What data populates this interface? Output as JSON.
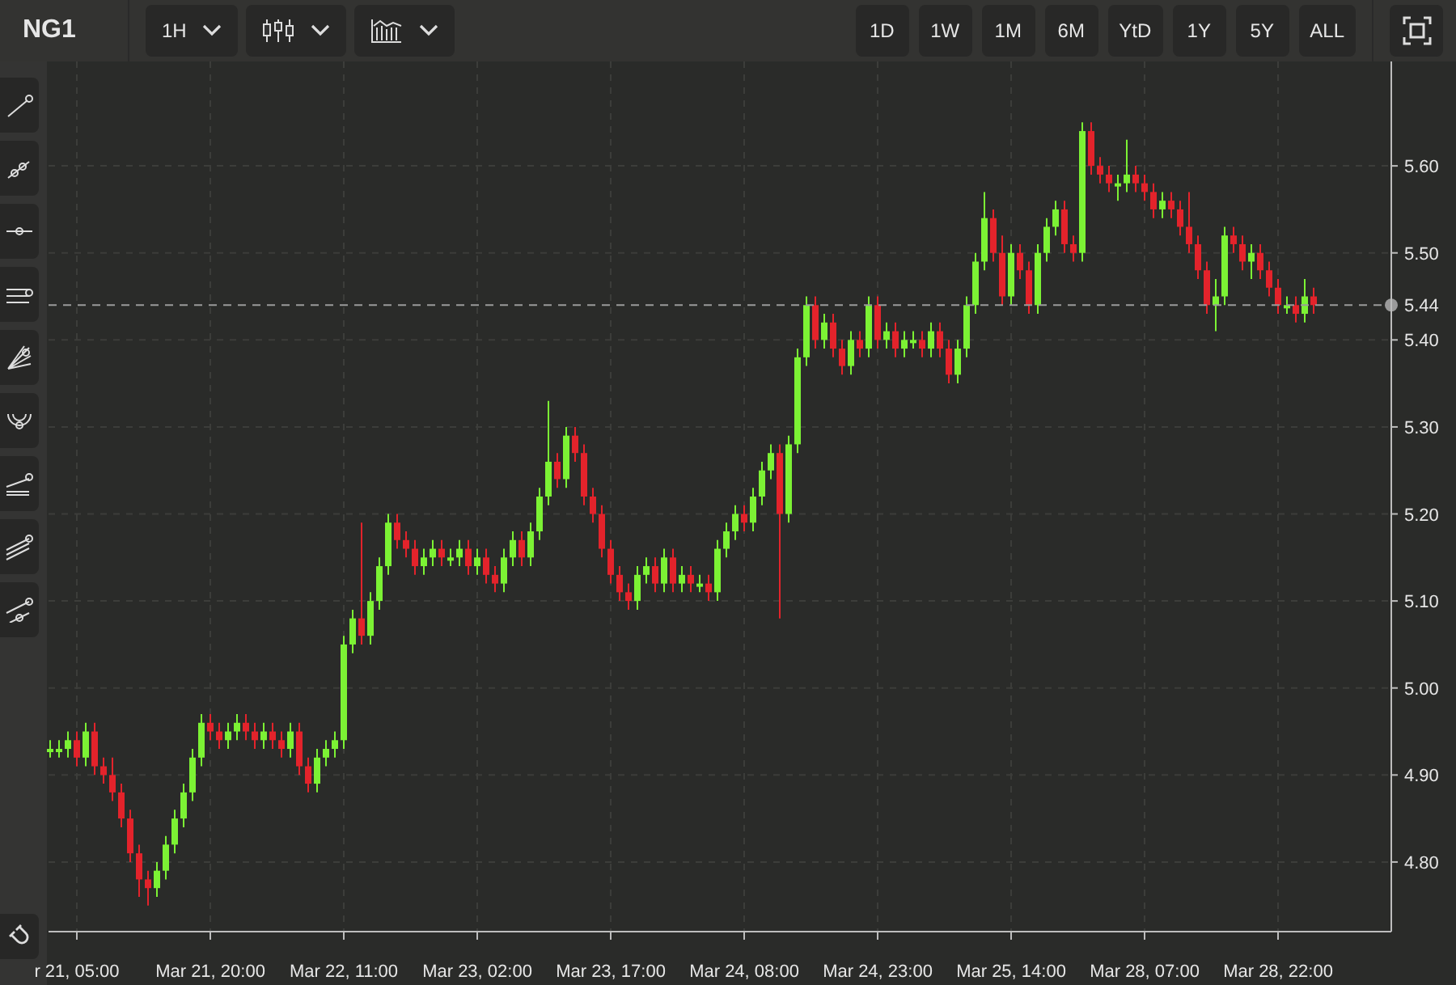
{
  "symbol": "NG1",
  "interval": {
    "label": "1H"
  },
  "range_buttons": [
    "1D",
    "1W",
    "1M",
    "6M",
    "YtD",
    "1Y",
    "5Y",
    "ALL"
  ],
  "chart": {
    "chart_data": {
      "type": "candlestick",
      "grid": true,
      "ylim": [
        4.72,
        5.72
      ],
      "ref_lines": [
        {
          "axis": "y",
          "value": 5.44,
          "label": "5.44"
        }
      ],
      "categories": [
        null,
        null,
        null,
        "r 21, 05:00",
        null,
        null,
        null,
        null,
        null,
        null,
        null,
        null,
        null,
        null,
        null,
        null,
        null,
        null,
        "Mar 21, 20:00",
        null,
        null,
        null,
        null,
        null,
        null,
        null,
        null,
        null,
        null,
        null,
        null,
        null,
        null,
        "Mar 22, 11:00",
        null,
        null,
        null,
        null,
        null,
        null,
        null,
        null,
        null,
        null,
        null,
        null,
        null,
        null,
        "Mar 23, 02:00",
        null,
        null,
        null,
        null,
        null,
        null,
        null,
        null,
        null,
        null,
        null,
        null,
        null,
        null,
        "Mar 23, 17:00",
        null,
        null,
        null,
        null,
        null,
        null,
        null,
        null,
        null,
        null,
        null,
        null,
        null,
        null,
        "Mar 24, 08:00",
        null,
        null,
        null,
        null,
        null,
        null,
        null,
        null,
        null,
        null,
        null,
        null,
        null,
        null,
        "Mar 24, 23:00",
        null,
        null,
        null,
        null,
        null,
        null,
        null,
        null,
        null,
        null,
        null,
        null,
        null,
        null,
        "Mar 25, 14:00",
        null,
        null,
        null,
        null,
        null,
        null,
        null,
        null,
        null,
        null,
        null,
        null,
        null,
        null,
        "Mar 28, 07:00",
        null,
        null,
        null,
        null,
        null,
        null,
        null,
        null,
        null,
        null,
        null,
        null,
        null,
        null,
        "Mar 28, 22:00",
        null,
        null,
        null,
        null
      ],
      "yticks": [
        {
          "value": 5.6,
          "label": "5.60"
        },
        {
          "value": 5.5,
          "label": "5.50"
        },
        {
          "value": 5.4,
          "label": "5.40"
        },
        {
          "value": 5.3,
          "label": "5.30"
        },
        {
          "value": 5.2,
          "label": "5.20"
        },
        {
          "value": 5.1,
          "label": "5.10"
        },
        {
          "value": 5.0,
          "label": "5.00"
        },
        {
          "value": 4.9,
          "label": "4.90"
        },
        {
          "value": 4.8,
          "label": "4.80"
        }
      ],
      "ohlc": [
        [
          4.93,
          4.94,
          4.92,
          4.93
        ],
        [
          4.93,
          4.94,
          4.92,
          4.93
        ],
        [
          4.93,
          4.95,
          4.92,
          4.94
        ],
        [
          4.94,
          4.95,
          4.91,
          4.92
        ],
        [
          4.92,
          4.96,
          4.91,
          4.95
        ],
        [
          4.95,
          4.96,
          4.9,
          4.91
        ],
        [
          4.91,
          4.92,
          4.89,
          4.9
        ],
        [
          4.9,
          4.92,
          4.87,
          4.88
        ],
        [
          4.88,
          4.89,
          4.84,
          4.85
        ],
        [
          4.85,
          4.86,
          4.8,
          4.81
        ],
        [
          4.81,
          4.82,
          4.76,
          4.78
        ],
        [
          4.78,
          4.79,
          4.75,
          4.77
        ],
        [
          4.77,
          4.8,
          4.76,
          4.79
        ],
        [
          4.79,
          4.83,
          4.78,
          4.82
        ],
        [
          4.82,
          4.86,
          4.81,
          4.85
        ],
        [
          4.85,
          4.89,
          4.84,
          4.88
        ],
        [
          4.88,
          4.93,
          4.87,
          4.92
        ],
        [
          4.92,
          4.97,
          4.91,
          4.96
        ],
        [
          4.96,
          4.97,
          4.94,
          4.95
        ],
        [
          4.95,
          4.96,
          4.93,
          4.94
        ],
        [
          4.94,
          4.96,
          4.93,
          4.95
        ],
        [
          4.95,
          4.97,
          4.94,
          4.96
        ],
        [
          4.96,
          4.97,
          4.94,
          4.95
        ],
        [
          4.95,
          4.96,
          4.93,
          4.94
        ],
        [
          4.94,
          4.96,
          4.93,
          4.95
        ],
        [
          4.95,
          4.96,
          4.93,
          4.94
        ],
        [
          4.94,
          4.95,
          4.92,
          4.93
        ],
        [
          4.93,
          4.96,
          4.92,
          4.95
        ],
        [
          4.95,
          4.96,
          4.9,
          4.91
        ],
        [
          4.91,
          4.92,
          4.88,
          4.89
        ],
        [
          4.89,
          4.93,
          4.88,
          4.92
        ],
        [
          4.92,
          4.94,
          4.91,
          4.93
        ],
        [
          4.93,
          4.95,
          4.92,
          4.94
        ],
        [
          4.94,
          5.06,
          4.93,
          5.05
        ],
        [
          5.05,
          5.09,
          5.04,
          5.08
        ],
        [
          5.08,
          5.19,
          5.05,
          5.06
        ],
        [
          5.06,
          5.11,
          5.05,
          5.1
        ],
        [
          5.1,
          5.15,
          5.09,
          5.14
        ],
        [
          5.14,
          5.2,
          5.13,
          5.19
        ],
        [
          5.19,
          5.2,
          5.16,
          5.17
        ],
        [
          5.17,
          5.18,
          5.15,
          5.16
        ],
        [
          5.16,
          5.17,
          5.13,
          5.14
        ],
        [
          5.14,
          5.16,
          5.13,
          5.15
        ],
        [
          5.15,
          5.17,
          5.14,
          5.16
        ],
        [
          5.16,
          5.17,
          5.14,
          5.15
        ],
        [
          5.15,
          5.16,
          5.14,
          5.15
        ],
        [
          5.15,
          5.17,
          5.14,
          5.16
        ],
        [
          5.16,
          5.17,
          5.13,
          5.14
        ],
        [
          5.14,
          5.16,
          5.13,
          5.15
        ],
        [
          5.15,
          5.16,
          5.12,
          5.13
        ],
        [
          5.13,
          5.14,
          5.11,
          5.12
        ],
        [
          5.12,
          5.16,
          5.11,
          5.15
        ],
        [
          5.15,
          5.18,
          5.14,
          5.17
        ],
        [
          5.17,
          5.18,
          5.14,
          5.15
        ],
        [
          5.15,
          5.19,
          5.14,
          5.18
        ],
        [
          5.18,
          5.23,
          5.17,
          5.22
        ],
        [
          5.22,
          5.33,
          5.21,
          5.26
        ],
        [
          5.26,
          5.27,
          5.23,
          5.24
        ],
        [
          5.24,
          5.3,
          5.23,
          5.29
        ],
        [
          5.29,
          5.3,
          5.26,
          5.27
        ],
        [
          5.27,
          5.28,
          5.21,
          5.22
        ],
        [
          5.22,
          5.23,
          5.19,
          5.2
        ],
        [
          5.2,
          5.21,
          5.15,
          5.16
        ],
        [
          5.16,
          5.17,
          5.12,
          5.13
        ],
        [
          5.13,
          5.14,
          5.1,
          5.11
        ],
        [
          5.11,
          5.12,
          5.09,
          5.1
        ],
        [
          5.1,
          5.14,
          5.09,
          5.13
        ],
        [
          5.13,
          5.15,
          5.12,
          5.14
        ],
        [
          5.14,
          5.15,
          5.11,
          5.12
        ],
        [
          5.12,
          5.16,
          5.11,
          5.15
        ],
        [
          5.15,
          5.16,
          5.11,
          5.12
        ],
        [
          5.12,
          5.14,
          5.11,
          5.13
        ],
        [
          5.13,
          5.14,
          5.11,
          5.12
        ],
        [
          5.12,
          5.13,
          5.11,
          5.12
        ],
        [
          5.12,
          5.13,
          5.1,
          5.11
        ],
        [
          5.11,
          5.17,
          5.1,
          5.16
        ],
        [
          5.16,
          5.19,
          5.15,
          5.18
        ],
        [
          5.18,
          5.21,
          5.17,
          5.2
        ],
        [
          5.2,
          5.21,
          5.18,
          5.19
        ],
        [
          5.19,
          5.23,
          5.18,
          5.22
        ],
        [
          5.22,
          5.26,
          5.21,
          5.25
        ],
        [
          5.25,
          5.28,
          5.24,
          5.27
        ],
        [
          5.27,
          5.28,
          5.08,
          5.2
        ],
        [
          5.2,
          5.29,
          5.19,
          5.28
        ],
        [
          5.28,
          5.39,
          5.27,
          5.38
        ],
        [
          5.38,
          5.45,
          5.37,
          5.44
        ],
        [
          5.44,
          5.45,
          5.39,
          5.4
        ],
        [
          5.4,
          5.43,
          5.39,
          5.42
        ],
        [
          5.42,
          5.43,
          5.38,
          5.39
        ],
        [
          5.39,
          5.4,
          5.36,
          5.37
        ],
        [
          5.37,
          5.41,
          5.36,
          5.4
        ],
        [
          5.4,
          5.41,
          5.38,
          5.39
        ],
        [
          5.39,
          5.45,
          5.38,
          5.44
        ],
        [
          5.44,
          5.45,
          5.39,
          5.4
        ],
        [
          5.4,
          5.42,
          5.39,
          5.41
        ],
        [
          5.41,
          5.42,
          5.38,
          5.39
        ],
        [
          5.39,
          5.41,
          5.38,
          5.4
        ],
        [
          5.4,
          5.41,
          5.39,
          5.4
        ],
        [
          5.4,
          5.41,
          5.38,
          5.39
        ],
        [
          5.39,
          5.42,
          5.38,
          5.41
        ],
        [
          5.41,
          5.42,
          5.38,
          5.39
        ],
        [
          5.39,
          5.4,
          5.35,
          5.36
        ],
        [
          5.36,
          5.4,
          5.35,
          5.39
        ],
        [
          5.39,
          5.45,
          5.38,
          5.44
        ],
        [
          5.44,
          5.5,
          5.43,
          5.49
        ],
        [
          5.49,
          5.57,
          5.48,
          5.54
        ],
        [
          5.54,
          5.55,
          5.49,
          5.5
        ],
        [
          5.5,
          5.52,
          5.44,
          5.45
        ],
        [
          5.45,
          5.51,
          5.44,
          5.5
        ],
        [
          5.5,
          5.51,
          5.47,
          5.48
        ],
        [
          5.48,
          5.49,
          5.43,
          5.44
        ],
        [
          5.44,
          5.51,
          5.43,
          5.5
        ],
        [
          5.5,
          5.54,
          5.49,
          5.53
        ],
        [
          5.53,
          5.56,
          5.52,
          5.55
        ],
        [
          5.55,
          5.56,
          5.5,
          5.51
        ],
        [
          5.51,
          5.52,
          5.49,
          5.5
        ],
        [
          5.5,
          5.65,
          5.49,
          5.64
        ],
        [
          5.64,
          5.65,
          5.59,
          5.6
        ],
        [
          5.6,
          5.61,
          5.58,
          5.59
        ],
        [
          5.59,
          5.6,
          5.57,
          5.58
        ],
        [
          5.58,
          5.59,
          5.56,
          5.58
        ],
        [
          5.58,
          5.63,
          5.57,
          5.59
        ],
        [
          5.59,
          5.6,
          5.57,
          5.58
        ],
        [
          5.58,
          5.59,
          5.56,
          5.57
        ],
        [
          5.57,
          5.58,
          5.54,
          5.55
        ],
        [
          5.55,
          5.57,
          5.54,
          5.56
        ],
        [
          5.56,
          5.57,
          5.54,
          5.55
        ],
        [
          5.55,
          5.56,
          5.52,
          5.53
        ],
        [
          5.53,
          5.57,
          5.5,
          5.51
        ],
        [
          5.51,
          5.52,
          5.47,
          5.48
        ],
        [
          5.48,
          5.49,
          5.43,
          5.44
        ],
        [
          5.44,
          5.47,
          5.41,
          5.45
        ],
        [
          5.45,
          5.53,
          5.44,
          5.52
        ],
        [
          5.52,
          5.53,
          5.5,
          5.51
        ],
        [
          5.51,
          5.52,
          5.48,
          5.49
        ],
        [
          5.49,
          5.51,
          5.47,
          5.5
        ],
        [
          5.5,
          5.51,
          5.47,
          5.48
        ],
        [
          5.48,
          5.49,
          5.45,
          5.46
        ],
        [
          5.46,
          5.47,
          5.43,
          5.44
        ],
        [
          5.44,
          5.45,
          5.43,
          5.44
        ],
        [
          5.44,
          5.45,
          5.42,
          5.43
        ],
        [
          5.43,
          5.47,
          5.42,
          5.45
        ],
        [
          5.45,
          5.46,
          5.43,
          5.44
        ]
      ]
    }
  }
}
